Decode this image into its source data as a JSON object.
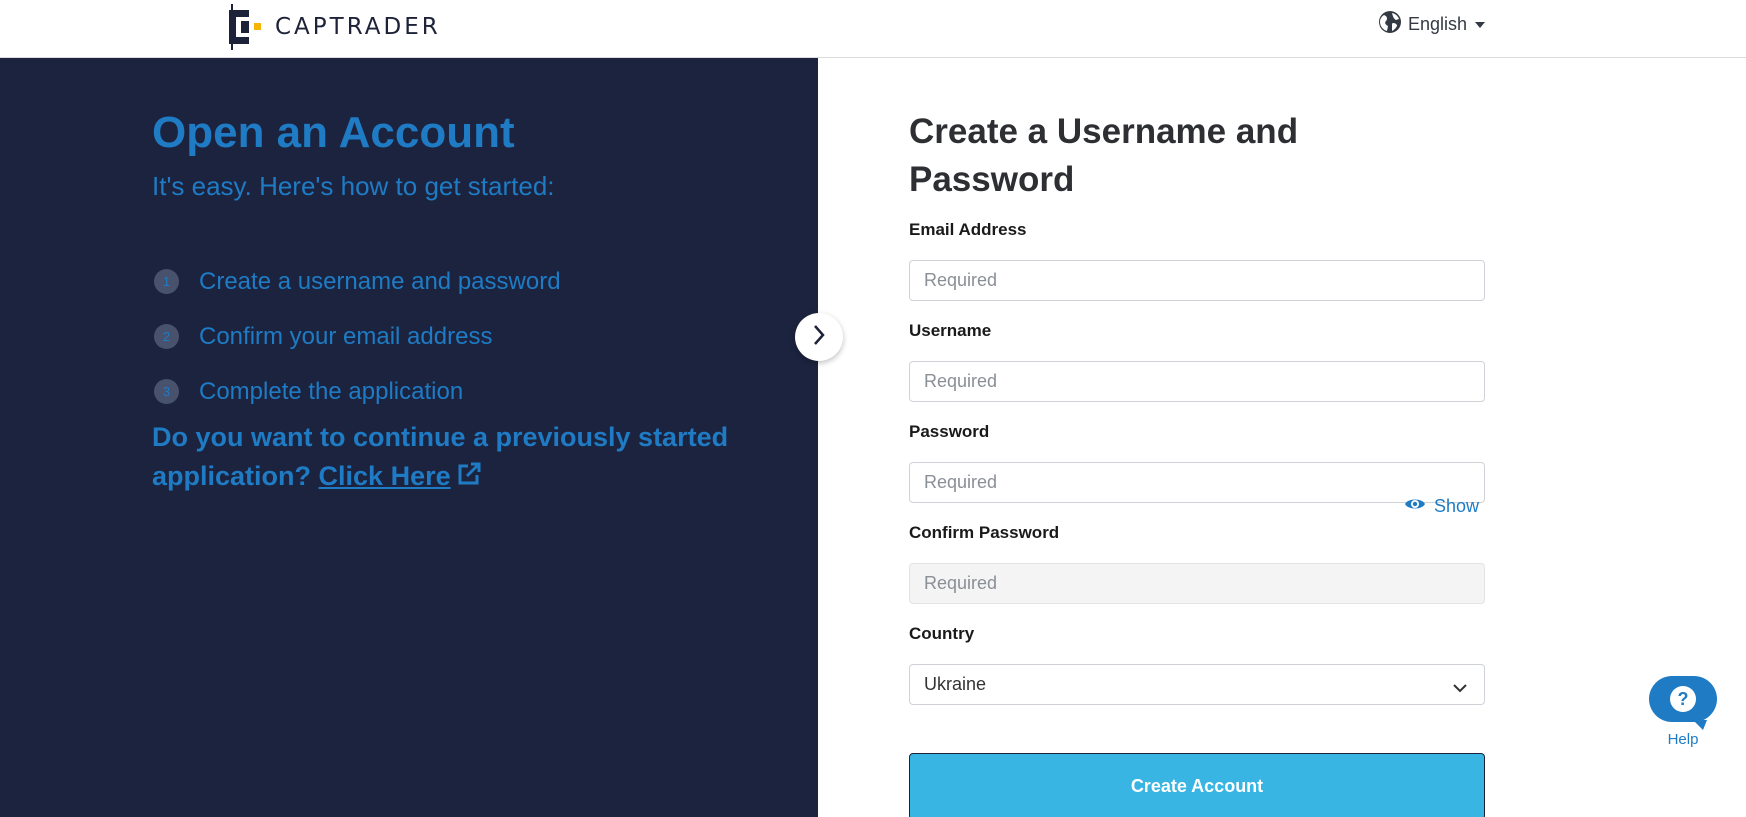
{
  "header": {
    "brand": "CAPTRADER",
    "language": "English",
    "colors": {
      "brand_yellow": "#f5b500",
      "brand_dark": "#1d2238"
    }
  },
  "intro": {
    "title": "Open an Account",
    "subtitle": "It's easy. Here's how to get started:",
    "steps": [
      {
        "number": "1",
        "label": "Create a username and password"
      },
      {
        "number": "2",
        "label": "Confirm your email address"
      },
      {
        "number": "3",
        "label": "Complete the application"
      }
    ],
    "continue_text": "Do you want to continue a previously started application?",
    "continue_link": "Click Here",
    "colors": {
      "panel_bg": "#1c233f",
      "accent": "#1e7bc4"
    }
  },
  "form": {
    "title": "Create a Username and Password",
    "email_label": "Email Address",
    "email_placeholder": "Required",
    "username_label": "Username",
    "username_placeholder": "Required",
    "password_label": "Password",
    "password_placeholder": "Required",
    "show_label": "Show",
    "confirm_label": "Confirm Password",
    "confirm_placeholder": "Required",
    "country_label": "Country",
    "country_value": "Ukraine",
    "submit_label": "Create Account",
    "colors": {
      "submit_bg": "#38b5e3"
    }
  },
  "help": {
    "icon_glyph": "?",
    "label": "Help"
  },
  "icons": [
    "captrader-logo-icon",
    "globe-icon",
    "caret-down-icon",
    "chevron-right-icon",
    "external-link-icon",
    "eye-icon",
    "chevron-down-icon",
    "help-icon"
  ]
}
